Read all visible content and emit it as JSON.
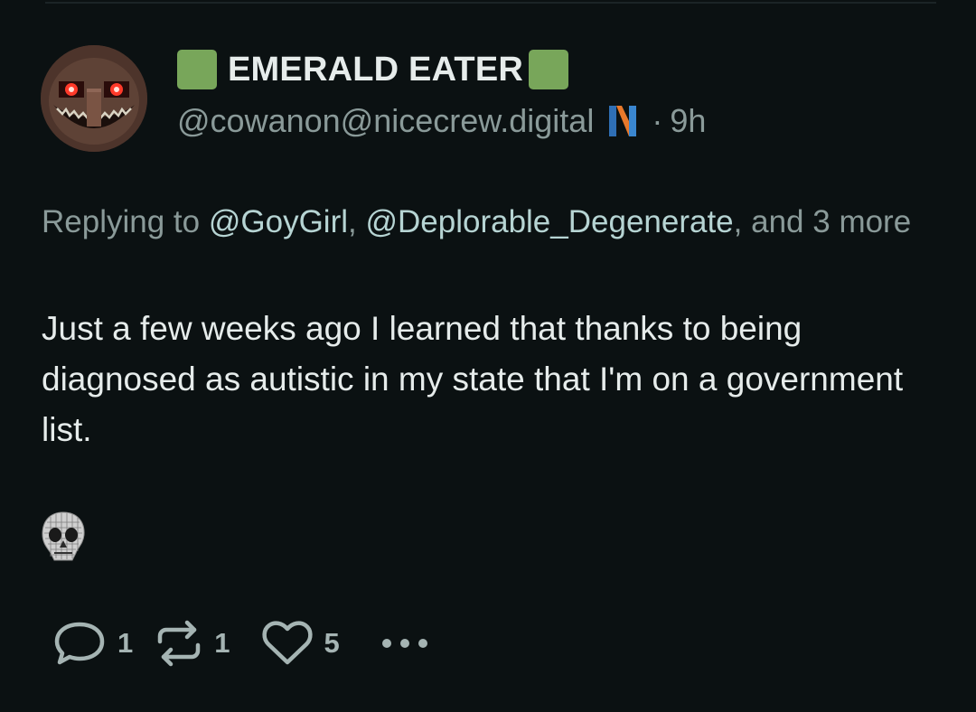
{
  "post": {
    "display_name": "EMERALD EATER",
    "handle": "@cowanon@nicecrew.digital",
    "separator": "·",
    "time": "9h",
    "reply": {
      "prefix": "Replying to",
      "mention_1": "@GoyGirl",
      "comma_1": ",",
      "mention_2": "@Deplorable_Degenerate",
      "suffix": ", and",
      "more": "3 more"
    },
    "text": "Just a few weeks ago I learned that thanks to being diagnosed as autistic in my state that I'm on a government list.",
    "counts": {
      "replies": "1",
      "reposts": "1",
      "likes": "5"
    }
  },
  "icons": {
    "name_emoji": "green-square-icon",
    "instance": "nicecrew-instance-icon",
    "custom_emoji": "skull-emoji-icon",
    "reply": "speech-bubble-icon",
    "repost": "repost-arrows-icon",
    "like": "heart-icon",
    "more": "ellipsis-icon"
  },
  "colors": {
    "background": "#0b1112",
    "text": "#e6eceb",
    "muted": "#8a9a99",
    "mention": "#b6d4d3",
    "emoji_green": "#78a65a"
  }
}
